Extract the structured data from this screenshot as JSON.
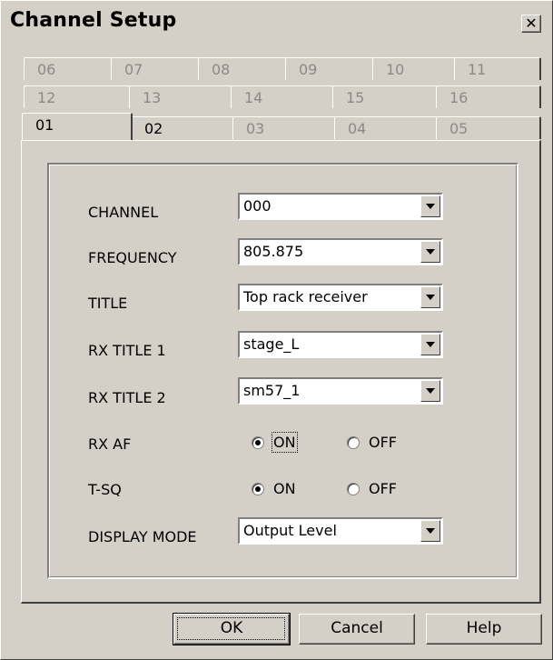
{
  "window": {
    "title": "Channel Setup",
    "close_label": "✕"
  },
  "tabs": {
    "row1": [
      {
        "label": "06",
        "enabled": false
      },
      {
        "label": "07",
        "enabled": false
      },
      {
        "label": "08",
        "enabled": false
      },
      {
        "label": "09",
        "enabled": false
      },
      {
        "label": "10",
        "enabled": false
      },
      {
        "label": "11",
        "enabled": false
      }
    ],
    "row2": [
      {
        "label": "12",
        "enabled": false
      },
      {
        "label": "13",
        "enabled": false
      },
      {
        "label": "14",
        "enabled": false
      },
      {
        "label": "15",
        "enabled": false
      },
      {
        "label": "16",
        "enabled": false
      }
    ],
    "row3": [
      {
        "label": "01",
        "enabled": true,
        "active": true
      },
      {
        "label": "02",
        "enabled": true
      },
      {
        "label": "03",
        "enabled": false
      },
      {
        "label": "04",
        "enabled": false
      },
      {
        "label": "05",
        "enabled": false
      }
    ]
  },
  "form": {
    "channel": {
      "label": "CHANNEL",
      "value": "000"
    },
    "frequency": {
      "label": "FREQUENCY",
      "value": "805.875"
    },
    "title": {
      "label": "TITLE",
      "value": "Top rack receiver"
    },
    "rx_title_1": {
      "label": "RX TITLE 1",
      "value": "stage_L"
    },
    "rx_title_2": {
      "label": "RX TITLE 2",
      "value": "sm57_1"
    },
    "rx_af": {
      "label": "RX AF",
      "on_label": "ON",
      "off_label": "OFF",
      "selected": "ON"
    },
    "t_sq": {
      "label": "T-SQ",
      "on_label": "ON",
      "off_label": "OFF",
      "selected": "ON"
    },
    "display_mode": {
      "label": "DISPLAY MODE",
      "value": "Output Level"
    }
  },
  "buttons": {
    "ok": "OK",
    "cancel": "Cancel",
    "help": "Help"
  },
  "colors": {
    "face": "#d4d0c8",
    "disabled_text": "#8a8a8a"
  }
}
